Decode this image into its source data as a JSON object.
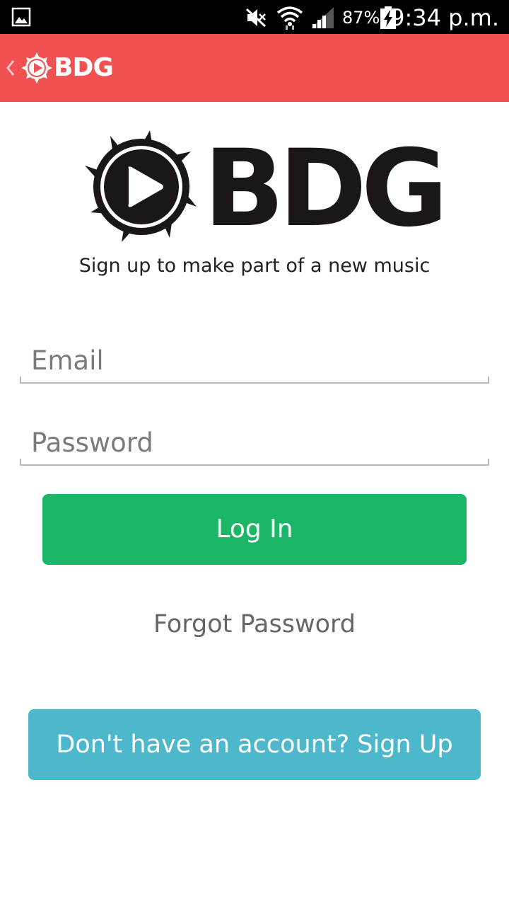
{
  "status_bar": {
    "battery_percent": "87%",
    "time": "9:34 p.m.",
    "icons": [
      "gallery-icon",
      "mute-icon",
      "wifi-icon",
      "signal-icon",
      "battery-charging-icon"
    ]
  },
  "app_bar": {
    "logo_text": "BDG",
    "icons": [
      "back-chevron-icon",
      "play-gear-logo-icon"
    ]
  },
  "hero": {
    "logo_text": "BDG",
    "tagline": "Sign up to make part of a new music"
  },
  "form": {
    "email": {
      "value": "",
      "placeholder": "Email"
    },
    "password": {
      "value": "",
      "placeholder": "Password"
    },
    "login_label": "Log In",
    "forgot_label": "Forgot Password",
    "signup_label": "Don't have an account? Sign Up"
  },
  "colors": {
    "app_bar": "#f15151",
    "login_button": "#1bb666",
    "signup_button": "#4db8cc",
    "logo_dark": "#1b1717"
  }
}
